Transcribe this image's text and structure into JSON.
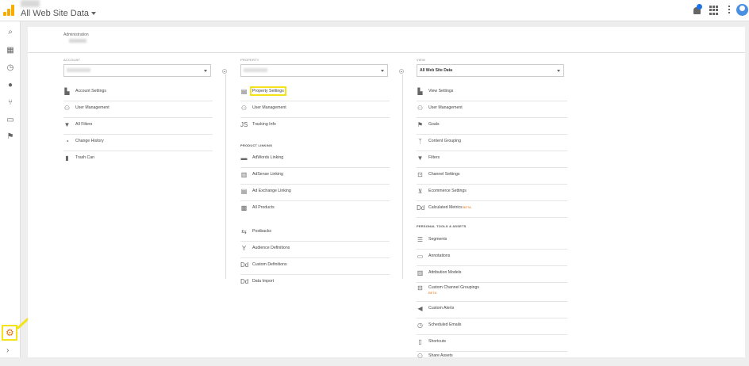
{
  "header": {
    "title": "All Web Site Data",
    "icons": {
      "bell": "bell-icon",
      "apps": "apps-grid-icon",
      "more": "more-vert-icon",
      "avatar": "account-avatar"
    },
    "brand_color": "#f9ab00"
  },
  "rail": {
    "items": [
      "search-icon",
      "dashboard-icon",
      "clock-icon",
      "person-icon",
      "branch-icon",
      "display-icon",
      "flag-icon"
    ],
    "gear": "gear-icon",
    "expand": "chevron-right-icon"
  },
  "panel": {
    "breadcrumb": "Administration"
  },
  "account": {
    "label": "ACCOUNT",
    "items": [
      {
        "label": "Account Settings",
        "icon": "building-icon"
      },
      {
        "label": "User Management",
        "icon": "people-icon"
      },
      {
        "label": "All Filters",
        "icon": "filter-icon"
      },
      {
        "label": "Change History",
        "icon": "history-icon"
      },
      {
        "label": "Trash Can",
        "icon": "trash-icon"
      }
    ]
  },
  "property": {
    "label": "PROPERTY",
    "items": [
      {
        "label": "Property Settings",
        "icon": "window-icon"
      },
      {
        "label": "User Management",
        "icon": "people-icon"
      },
      {
        "label": "Tracking Info",
        "icon": "js-icon"
      }
    ],
    "product_linking_label": "PRODUCT LINKING",
    "linking": [
      {
        "label": "AdWords Linking",
        "icon": "adwords-icon"
      },
      {
        "label": "AdSense Linking",
        "icon": "adsense-icon"
      },
      {
        "label": "Ad Exchange Linking",
        "icon": "adexchange-icon"
      },
      {
        "label": "All Products",
        "icon": "products-icon"
      }
    ],
    "more": [
      {
        "label": "Postbacks",
        "icon": "postback-icon"
      },
      {
        "label": "Audience Definitions",
        "icon": "audience-icon"
      },
      {
        "label": "Custom Definitions",
        "icon": "dd-icon"
      },
      {
        "label": "Data Import",
        "icon": "dd-icon"
      }
    ]
  },
  "view": {
    "label": "VIEW",
    "selected": "All Web Site Data",
    "items": [
      {
        "label": "View Settings",
        "icon": "doc-icon"
      },
      {
        "label": "User Management",
        "icon": "people-icon"
      },
      {
        "label": "Goals",
        "icon": "flag-icon"
      },
      {
        "label": "Content Grouping",
        "icon": "grouping-icon"
      },
      {
        "label": "Filters",
        "icon": "filter-icon"
      },
      {
        "label": "Channel Settings",
        "icon": "channel-icon"
      },
      {
        "label": "Ecommerce Settings",
        "icon": "cart-icon"
      },
      {
        "label": "Calculated Metrics",
        "icon": "dd-icon",
        "badge": "BETA"
      }
    ],
    "tools_label": "PERSONAL TOOLS & ASSETS",
    "tools": [
      {
        "label": "Segments",
        "icon": "segments-icon"
      },
      {
        "label": "Annotations",
        "icon": "annotation-icon"
      },
      {
        "label": "Attribution Models",
        "icon": "bars-icon"
      },
      {
        "label": "Custom Channel Groupings",
        "icon": "grouping-box-icon",
        "badge": "BETA"
      },
      {
        "label": "Custom Alerts",
        "icon": "megaphone-icon"
      },
      {
        "label": "Scheduled Emails",
        "icon": "alarm-icon"
      },
      {
        "label": "Shortcuts",
        "icon": "shortcut-icon"
      },
      {
        "label": "Share Assets",
        "icon": "share-icon"
      }
    ]
  }
}
